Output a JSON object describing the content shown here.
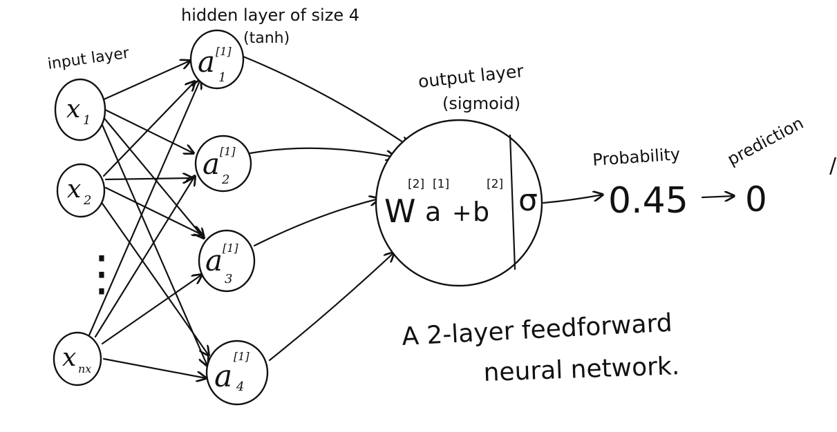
{
  "labels": {
    "input_layer": "input layer",
    "hidden_layer": "hidden layer of size 4",
    "hidden_activation": "(tanh)",
    "output_layer": "output layer",
    "output_activation": "(sigmoid)",
    "probability_label": "Probability",
    "prediction_label": "prediction",
    "caption_line1": "A 2-layer feedforward",
    "caption_line2": "neural network."
  },
  "inputs": [
    {
      "base": "x",
      "sub": "1"
    },
    {
      "base": "x",
      "sub": "2"
    },
    {
      "base": "x",
      "sub": "nx"
    }
  ],
  "ellipsis": "⋮",
  "hidden": [
    {
      "base": "a",
      "sup": "[1]",
      "sub": "1"
    },
    {
      "base": "a",
      "sup": "[1]",
      "sub": "2"
    },
    {
      "base": "a",
      "sup": "[1]",
      "sub": "3"
    },
    {
      "base": "a",
      "sup": "[1]",
      "sub": "4"
    }
  ],
  "output_node": {
    "w": "W",
    "w_sup": "[2]",
    "a": "a",
    "a_sup": "[1]",
    "plus": "+",
    "b": "b",
    "b_sup": "[2]",
    "sigma": "σ"
  },
  "probability_value": "0.45",
  "prediction_value": "0",
  "stray_mark": "/"
}
